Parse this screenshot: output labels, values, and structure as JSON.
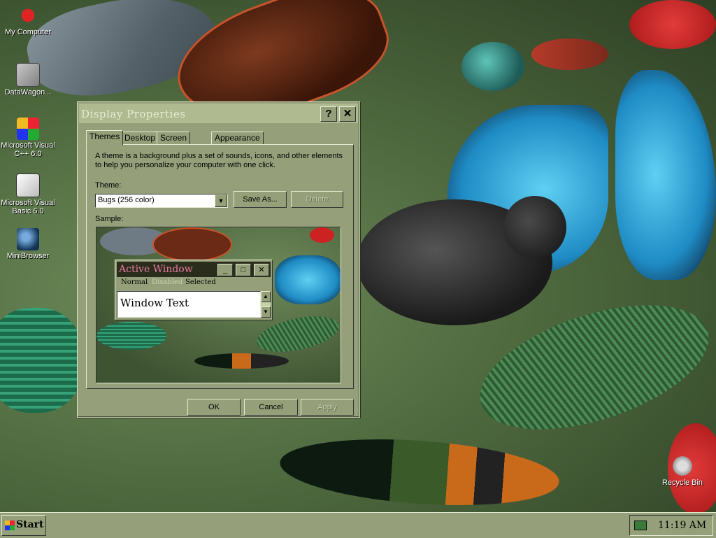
{
  "desktop": {
    "icons": [
      {
        "label": "My Computer",
        "icon": "computer-icon"
      },
      {
        "label": "DataWagon...",
        "icon": "shortcut-icon"
      },
      {
        "label": "Microsoft Visual C++ 6.0",
        "icon": "visual-cpp-icon"
      },
      {
        "label": "Microsoft Visual Basic 6.0",
        "icon": "visual-basic-icon"
      },
      {
        "label": "MiniBrowser",
        "icon": "browser-icon"
      },
      {
        "label": "Recycle Bin",
        "icon": "recycle-bin-icon"
      }
    ]
  },
  "dialog": {
    "title": "Display Properties",
    "help_glyph": "?",
    "close_glyph": "✕",
    "tabs": [
      {
        "label": "Themes"
      },
      {
        "label": "Desktop"
      },
      {
        "label": "Screen Saver"
      },
      {
        "label": "Appearance"
      }
    ],
    "description": "A theme is a background plus a set of sounds, icons, and other elements to help you personalize your computer with one click.",
    "theme_label": "Theme:",
    "theme_value": "Bugs (256 color)",
    "save_as_label": "Save As...",
    "delete_label": "Delete",
    "sample_label": "Sample:",
    "sample": {
      "window_title": "Active Window",
      "minimize_glyph": "_",
      "maximize_glyph": "□",
      "close_glyph": "✕",
      "menu_normal": "Normal",
      "menu_disabled": "Disabled",
      "menu_selected": "Selected",
      "window_text": "Window Text",
      "scroll_up": "▲",
      "scroll_down": "▼"
    },
    "ok_label": "OK",
    "cancel_label": "Cancel",
    "apply_label": "Apply"
  },
  "taskbar": {
    "start_label": "Start",
    "clock": "11:19 AM"
  },
  "colors": {
    "window_face": "#95a07a",
    "title_bar": "#b0ba90",
    "sample_title_text": "#e97aa2"
  }
}
